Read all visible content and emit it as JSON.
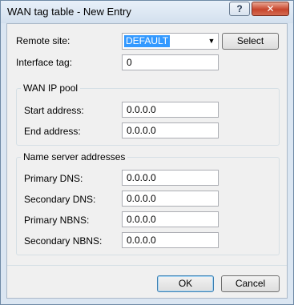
{
  "window": {
    "title": "WAN tag table - New Entry",
    "help_label": "?",
    "close_label": "✕"
  },
  "form": {
    "remote_site_label": "Remote site:",
    "remote_site_value": "DEFAULT",
    "select_button_label": "Select",
    "interface_tag_label": "Interface tag:",
    "interface_tag_value": "0"
  },
  "wan_ip_pool": {
    "title": "WAN IP pool",
    "start_label": "Start address:",
    "start_value": "0.0.0.0",
    "end_label": "End address:",
    "end_value": "0.0.0.0"
  },
  "name_servers": {
    "title": "Name server addresses",
    "primary_dns_label": "Primary DNS:",
    "primary_dns_value": "0.0.0.0",
    "secondary_dns_label": "Secondary DNS:",
    "secondary_dns_value": "0.0.0.0",
    "primary_nbns_label": "Primary NBNS:",
    "primary_nbns_value": "0.0.0.0",
    "secondary_nbns_label": "Secondary NBNS:",
    "secondary_nbns_value": "0.0.0.0"
  },
  "buttons": {
    "ok_label": "OK",
    "cancel_label": "Cancel"
  }
}
